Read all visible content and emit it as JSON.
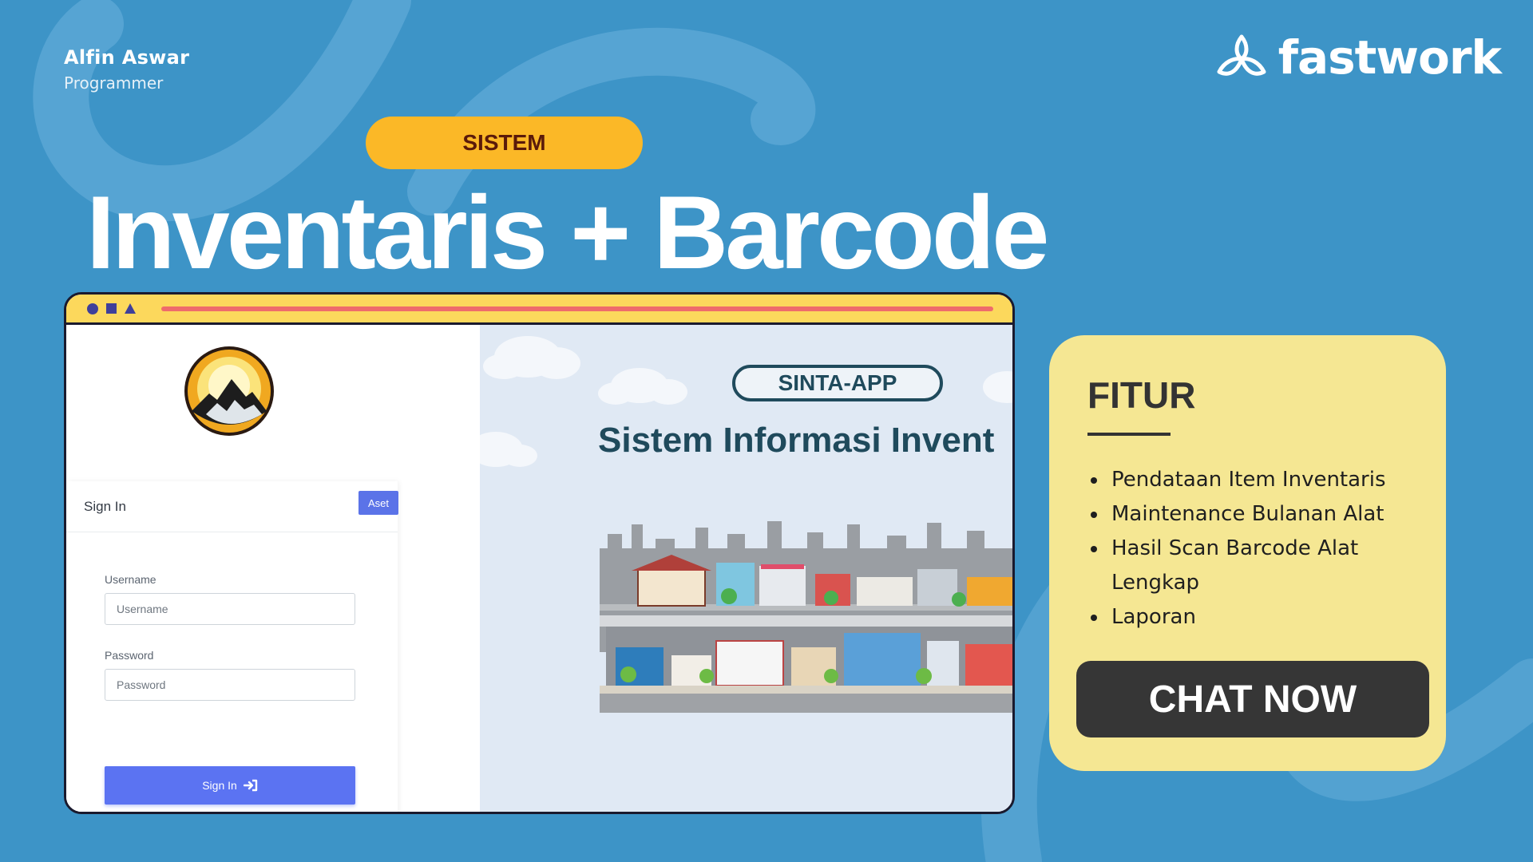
{
  "author": {
    "name": "Alfin Aswar",
    "role": "Programmer"
  },
  "brand": {
    "name": "fastwork",
    "icon": "fastwork-logo-icon"
  },
  "pill_label": "SISTEM",
  "headline": "Inventaris + Barcode",
  "login": {
    "title": "Sign In",
    "aset_label": "Aset",
    "username_label": "Username",
    "username_placeholder": "Username",
    "password_label": "Password",
    "password_placeholder": "Password",
    "submit_label": "Sign In",
    "submit_icon": "sign-in-icon",
    "logo_icon": "mountain-sun-emblem-icon"
  },
  "hero": {
    "badge": "SINTA-APP",
    "title": "Sistem Informasi Invent"
  },
  "features": {
    "title": "FITUR",
    "items": [
      "Pendataan Item Inventaris",
      "Maintenance Bulanan Alat",
      "Hasil Scan Barcode Alat Lengkap",
      "Laporan"
    ],
    "cta_label": "CHAT NOW"
  },
  "colors": {
    "background": "#3d94c7",
    "pill": "#fbb827",
    "browser_bar": "#fcd85c",
    "feature_card": "#f5e793",
    "cta": "#363636",
    "primary_button": "#5b73f2"
  }
}
